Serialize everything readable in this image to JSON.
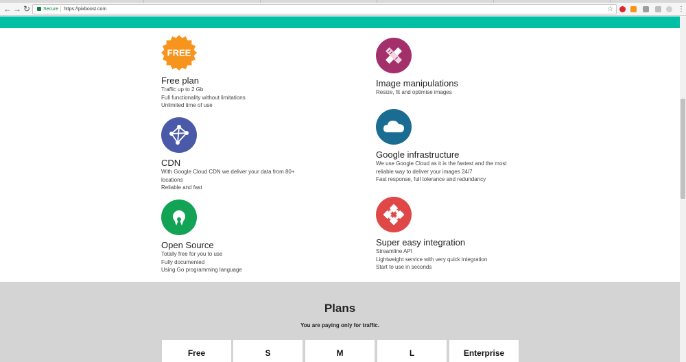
{
  "browser": {
    "secure_label": "Secure",
    "url": "https://pixboost.com",
    "nav_back": "←",
    "nav_forward": "→",
    "nav_reload": "↻",
    "star": "☆",
    "menu": "⋮"
  },
  "features": {
    "free_plan": {
      "badge": "FREE",
      "title": "Free plan",
      "lines": [
        "Traffic up to 2 Gb",
        "Full functionality without limitations",
        "Unlimited time of use"
      ]
    },
    "image_manipulations": {
      "title": "Image manipulations",
      "lines": [
        "Resize, fit and optimise images"
      ]
    },
    "cdn": {
      "title": "CDN",
      "lines": [
        "With Google Cloud CDN we deliver your data from 80+",
        "locations",
        "Reliable and fast"
      ]
    },
    "google_infrastructure": {
      "title": "Google infrastructure",
      "lines": [
        "We use Google Cloud as it is the fastest and the most",
        "reliable way to deliver your images 24/7",
        "Fast response, full tolerance and redundancy"
      ]
    },
    "open_source": {
      "title": "Open Source",
      "lines": [
        "Totally free for you to use",
        "Fully documented",
        "Using Go programming language"
      ]
    },
    "easy_integration": {
      "title": "Super easy integration",
      "lines": [
        "Streamline API",
        "Lightweight service with very quick integration",
        "Start to use in seconds"
      ]
    }
  },
  "plans": {
    "title": "Plans",
    "subtitle": "You are paying only for traffic.",
    "cards": [
      {
        "name": "Free"
      },
      {
        "name": "S"
      },
      {
        "name": "M"
      },
      {
        "name": "L"
      },
      {
        "name": "Enterprise"
      }
    ]
  },
  "colors": {
    "accent": "#00bfa5",
    "free_badge": "#f7941d",
    "image_manipulations": "#a4306b",
    "cdn": "#4a5aa8",
    "google_infrastructure": "#1b6c92",
    "open_source": "#12a354",
    "easy_integration": "#e04848"
  }
}
